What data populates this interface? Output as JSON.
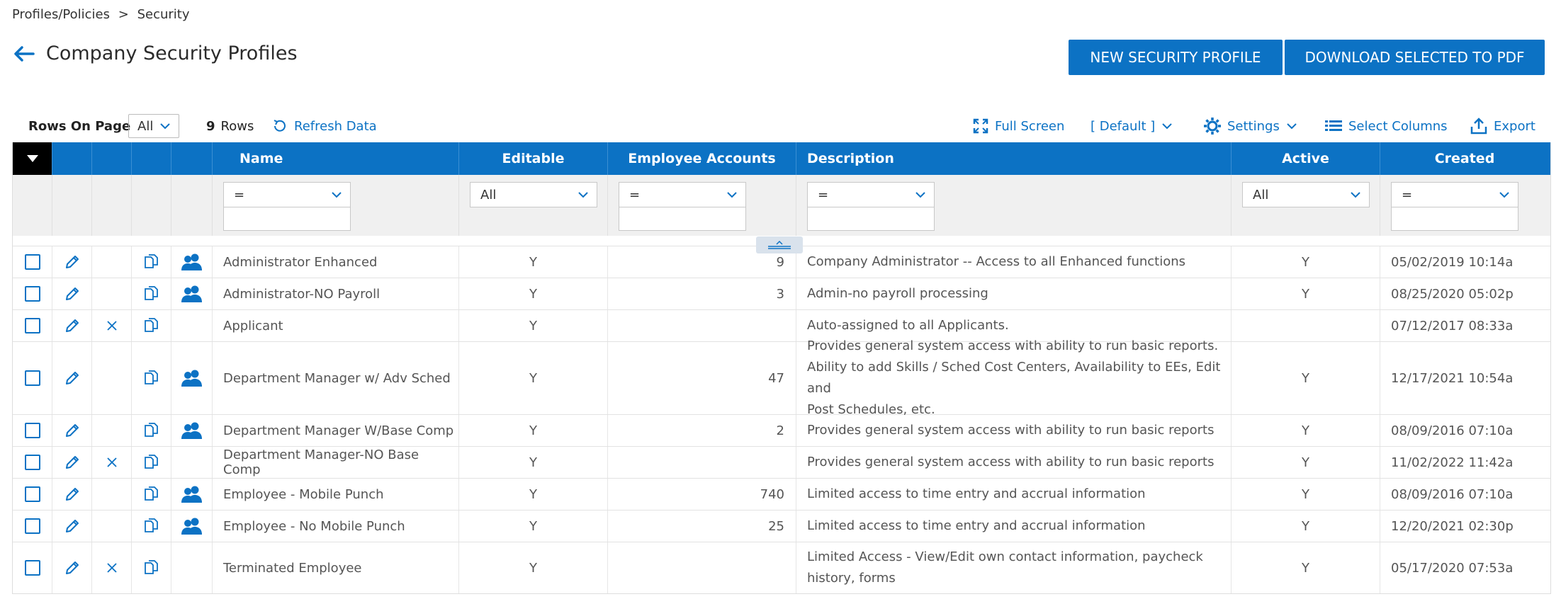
{
  "breadcrumb": {
    "parent": "Profiles/Policies",
    "separator": ">",
    "current": "Security"
  },
  "page": {
    "title": "Company Security Profiles"
  },
  "actions": {
    "new_profile": "NEW SECURITY PROFILE",
    "download_pdf": "DOWNLOAD SELECTED TO PDF"
  },
  "toolbar": {
    "rows_on_page_label": "Rows On Page",
    "rows_on_page_value": "All",
    "row_count": "9",
    "row_count_label": "Rows",
    "refresh": "Refresh Data",
    "full_screen": "Full Screen",
    "view": "[ Default ]",
    "settings": "Settings",
    "select_columns": "Select Columns",
    "export": "Export"
  },
  "columns": {
    "name": "Name",
    "editable": "Editable",
    "employee_accounts": "Employee Accounts",
    "description": "Description",
    "active": "Active",
    "created": "Created"
  },
  "filters": {
    "name": "=",
    "editable": "All",
    "employee_accounts": "=",
    "description": "=",
    "active": "All",
    "created": "="
  },
  "rows": [
    {
      "name": "Administrator Enhanced",
      "editable": "Y",
      "accounts": "9",
      "desc": [
        "Company Administrator -- Access to all Enhanced functions"
      ],
      "active": "Y",
      "created": "05/02/2019 10:14a",
      "deletable": false,
      "has_users": true
    },
    {
      "name": "Administrator-NO Payroll",
      "editable": "Y",
      "accounts": "3",
      "desc": [
        "Admin-no payroll processing"
      ],
      "active": "Y",
      "created": "08/25/2020 05:02p",
      "deletable": false,
      "has_users": true
    },
    {
      "name": "Applicant",
      "editable": "Y",
      "accounts": "",
      "desc": [
        "Auto-assigned to all Applicants."
      ],
      "active": "",
      "created": "07/12/2017 08:33a",
      "deletable": true,
      "has_users": false
    },
    {
      "name": "Department Manager w/ Adv Sched",
      "editable": "Y",
      "accounts": "47",
      "desc": [
        "Provides general system access with ability to run basic reports.",
        "Ability to add Skills / Sched Cost Centers, Availability to EEs, Edit and",
        "Post Schedules, etc."
      ],
      "active": "Y",
      "created": "12/17/2021 10:54a",
      "deletable": false,
      "has_users": true
    },
    {
      "name": "Department Manager W/Base Comp",
      "editable": "Y",
      "accounts": "2",
      "desc": [
        "Provides general system access with ability to run basic reports"
      ],
      "active": "Y",
      "created": "08/09/2016 07:10a",
      "deletable": false,
      "has_users": true
    },
    {
      "name": "Department Manager-NO Base Comp",
      "editable": "Y",
      "accounts": "",
      "desc": [
        "Provides general system access with ability to run basic reports"
      ],
      "active": "Y",
      "created": "11/02/2022 11:42a",
      "deletable": true,
      "has_users": false
    },
    {
      "name": "Employee - Mobile Punch",
      "editable": "Y",
      "accounts": "740",
      "desc": [
        "Limited access to time entry and accrual information"
      ],
      "active": "Y",
      "created": "08/09/2016 07:10a",
      "deletable": false,
      "has_users": true
    },
    {
      "name": "Employee - No Mobile Punch",
      "editable": "Y",
      "accounts": "25",
      "desc": [
        "Limited access to time entry and accrual information"
      ],
      "active": "Y",
      "created": "12/20/2021 02:30p",
      "deletable": false,
      "has_users": true
    },
    {
      "name": "Terminated Employee",
      "editable": "Y",
      "accounts": "",
      "desc": [
        "Limited Access - View/Edit own contact information, paycheck",
        "history, forms"
      ],
      "active": "Y",
      "created": "05/17/2020 07:53a",
      "deletable": true,
      "has_users": false
    }
  ],
  "icons": {
    "back": "arrow-left-icon",
    "edit": "pencil-icon",
    "delete": "x-icon",
    "copy": "copy-icon",
    "users": "users-icon",
    "refresh": "refresh-icon",
    "full_screen": "expand-icon",
    "settings": "gear-icon",
    "columns": "columns-icon",
    "export": "export-icon"
  },
  "colors": {
    "primary": "#0c72c4",
    "header_text": "#ffffff",
    "first_header_cell": "#000000"
  }
}
